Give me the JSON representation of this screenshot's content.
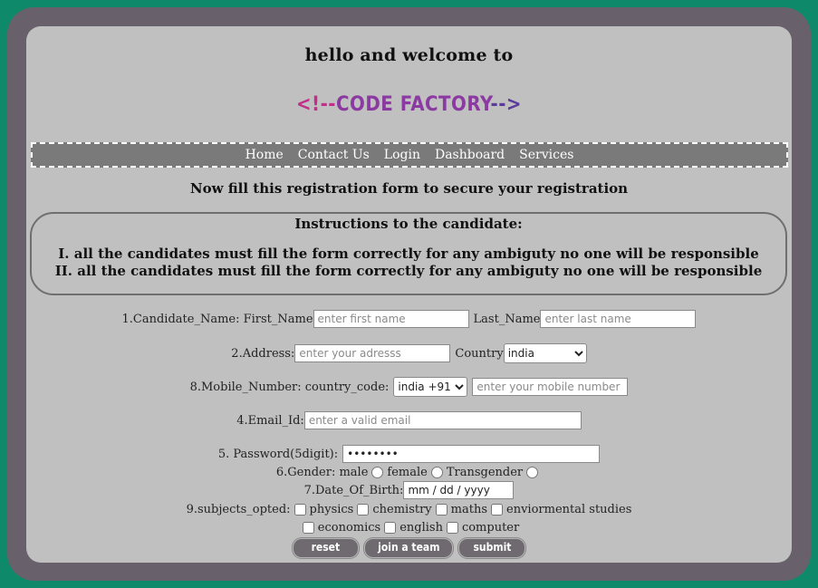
{
  "header": {
    "welcome": "hello and welcome to",
    "logo_open": "<!--",
    "logo_name": "CODE FACTORY",
    "logo_close": "-->"
  },
  "nav": [
    "Home",
    "Contact Us",
    "Login",
    "Dashboard",
    "Services"
  ],
  "heading": "Now fill this registration form to secure your registration",
  "instructions": {
    "title": "Instructions to the candidate:",
    "items": [
      "I. all the candidates must fill the form correctly for any ambiguty no one will be responsible",
      "II. all the candidates must fill the form correctly for any ambiguty no one will be responsible"
    ]
  },
  "form": {
    "name_label": "1.Candidate_Name: First_Name",
    "first_name_placeholder": "enter first name",
    "last_name_label": "Last_Name",
    "last_name_placeholder": "enter last name",
    "address_label": "2.Address:",
    "address_placeholder": "enter your adresss",
    "country_label": "Country",
    "country_value": "india",
    "mobile_label": "8.Mobile_Number: country_code:",
    "country_code_value": "india +91",
    "mobile_placeholder": "enter your mobile number",
    "email_label": "4.Email_Id:",
    "email_placeholder": "enter a valid email",
    "password_label": "5. Password(5digit):",
    "password_value": "••••••••",
    "gender_label": "6.Gender: male",
    "gender_female": "female",
    "gender_trans": "Transgender",
    "dob_label": "7.Date_Of_Birth:",
    "dob_value": "mm / dd / yyyy",
    "subjects_label": "9.subjects_opted:",
    "subjects_row1": [
      "physics",
      "chemistry",
      "maths",
      "enviormental studies"
    ],
    "subjects_row2": [
      "economics",
      "english",
      "computer"
    ]
  },
  "buttons": {
    "reset": "reset",
    "join": "join a team",
    "submit": "submit"
  }
}
